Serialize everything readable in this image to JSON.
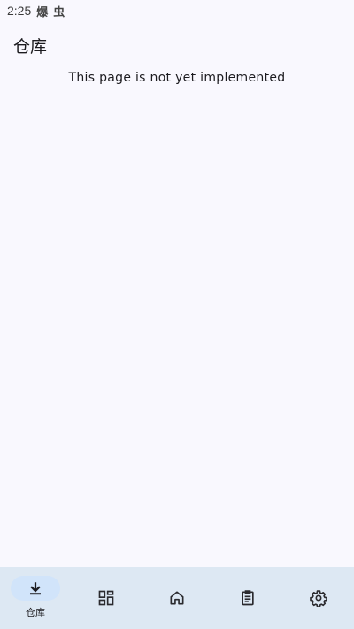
{
  "status_bar": {
    "time": "2:25",
    "notif_icon_1": "爆",
    "notif_icon_2": "虫"
  },
  "app_bar": {
    "title": "仓库"
  },
  "main": {
    "message": "This page is not yet implemented"
  },
  "bottom_nav": {
    "items": [
      {
        "label": "仓库",
        "icon": "download-icon",
        "active": true
      },
      {
        "label": "",
        "icon": "grid-icon",
        "active": false
      },
      {
        "label": "",
        "icon": "home-icon",
        "active": false
      },
      {
        "label": "",
        "icon": "clipboard-icon",
        "active": false
      },
      {
        "label": "",
        "icon": "gear-icon",
        "active": false
      }
    ]
  },
  "colors": {
    "background": "#f9f8fe",
    "nav_background": "#dde8f3",
    "active_indicator": "#d1e4fa"
  }
}
